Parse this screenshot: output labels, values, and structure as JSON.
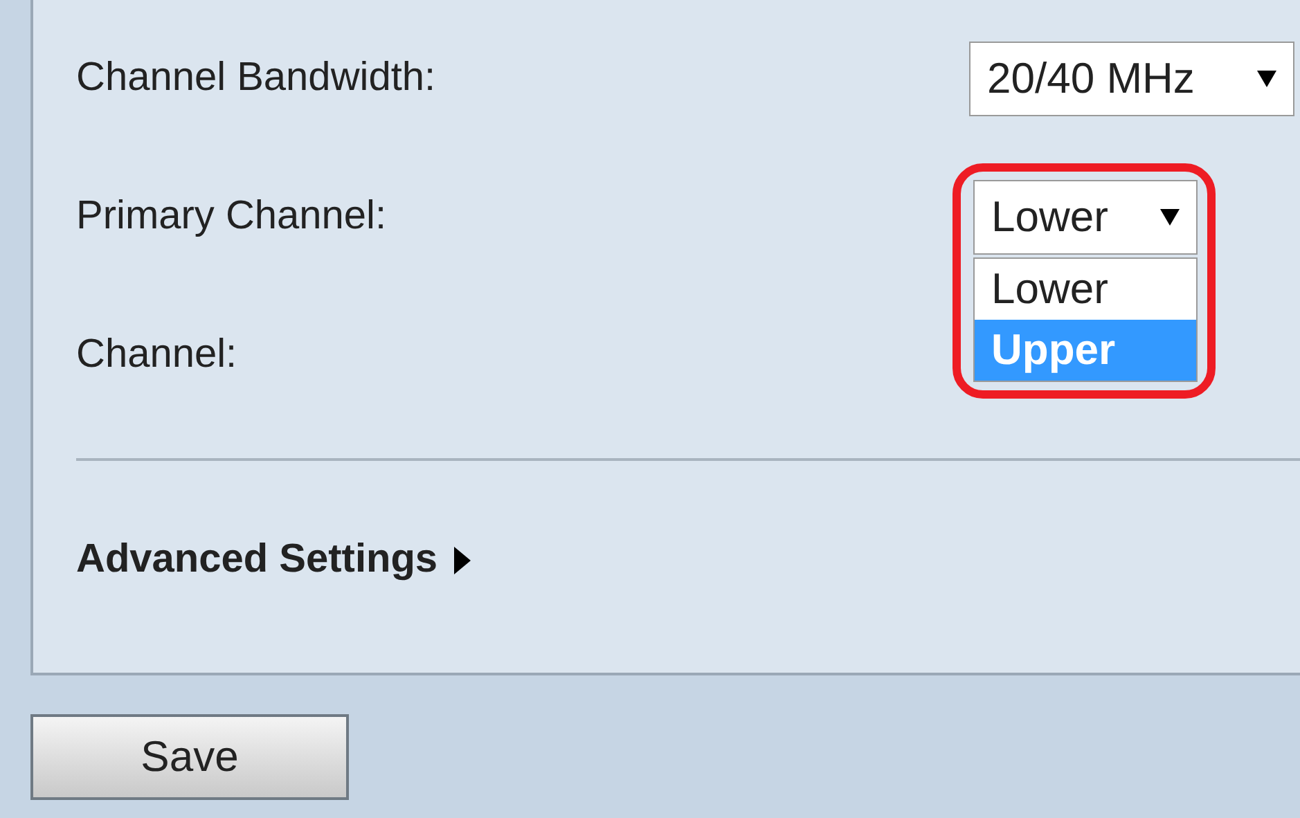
{
  "fields": [
    {
      "label": "Channel Bandwidth:",
      "kind": "select",
      "value": "20/40 MHz",
      "open": false
    },
    {
      "label": "Primary Channel:",
      "kind": "select",
      "value": "Lower",
      "open": true,
      "highlighted": true,
      "options": [
        {
          "label": "Lower",
          "highlighted": false
        },
        {
          "label": "Upper",
          "highlighted": true
        }
      ]
    },
    {
      "label": "Channel:",
      "kind": "label"
    }
  ],
  "advanced": {
    "label": "Advanced Settings",
    "expanded": false
  },
  "buttons": [
    {
      "label": "Save"
    }
  ]
}
